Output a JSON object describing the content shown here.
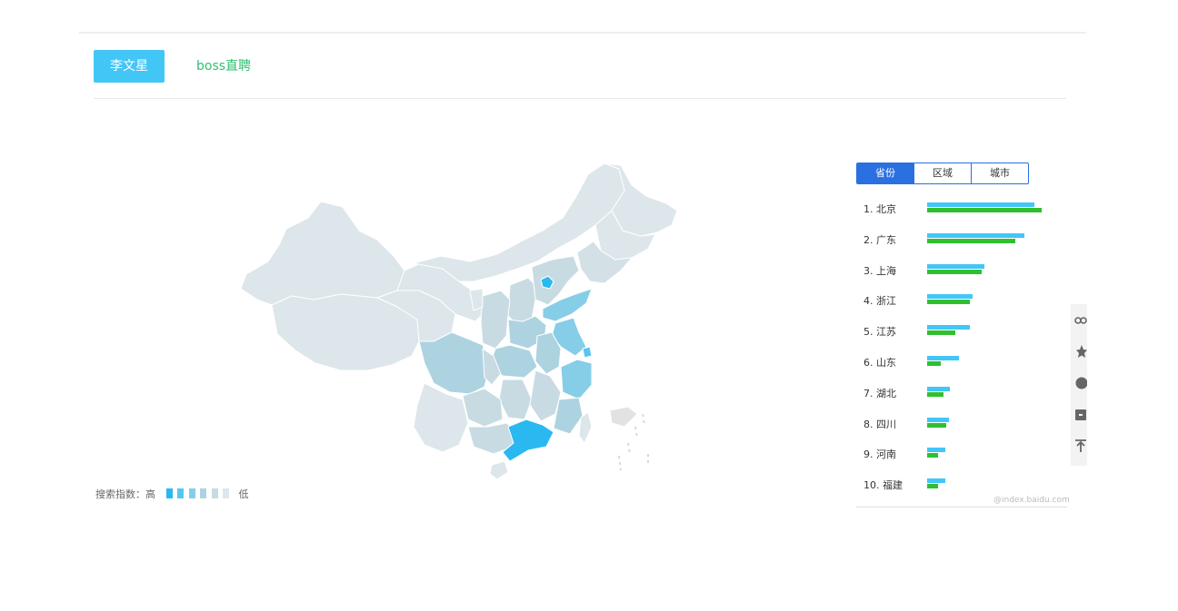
{
  "keywords": {
    "active": "李文星",
    "second": "boss直聘"
  },
  "legend": {
    "label": "搜索指数：高",
    "low": "低",
    "shades": [
      "#2ab8f0",
      "#56c6f0",
      "#86cde8",
      "#aed3e0",
      "#c8dbe3",
      "#dde6ea"
    ]
  },
  "tabs": {
    "province": "省份",
    "region": "区域",
    "city": "城市"
  },
  "ranking": [
    {
      "label": "1.  北京",
      "blue": 1.0,
      "green": 1.07
    },
    {
      "label": "2.  广东",
      "blue": 0.91,
      "green": 0.82
    },
    {
      "label": "3.  上海",
      "blue": 0.53,
      "green": 0.51
    },
    {
      "label": "4.  浙江",
      "blue": 0.42,
      "green": 0.4
    },
    {
      "label": "5.  江苏",
      "blue": 0.4,
      "green": 0.26
    },
    {
      "label": "6.  山东",
      "blue": 0.3,
      "green": 0.13
    },
    {
      "label": "7.  湖北",
      "blue": 0.21,
      "green": 0.15
    },
    {
      "label": "8.  四川",
      "blue": 0.2,
      "green": 0.18
    },
    {
      "label": "9.  河南",
      "blue": 0.17,
      "green": 0.1
    },
    {
      "label": "10. 福建",
      "blue": 0.17,
      "green": 0.1
    }
  ],
  "credit": "@index.baidu.com",
  "colors": {
    "accent": "#42c6f6",
    "second_keyword": "#2fbf71",
    "tab_blue": "#2a70e0",
    "bar_blue": "#42c6f6",
    "bar_green": "#2fbf2f"
  },
  "side_tools": [
    "share-icon",
    "star-icon",
    "help-icon",
    "feedback-icon",
    "back-to-top-icon"
  ]
}
